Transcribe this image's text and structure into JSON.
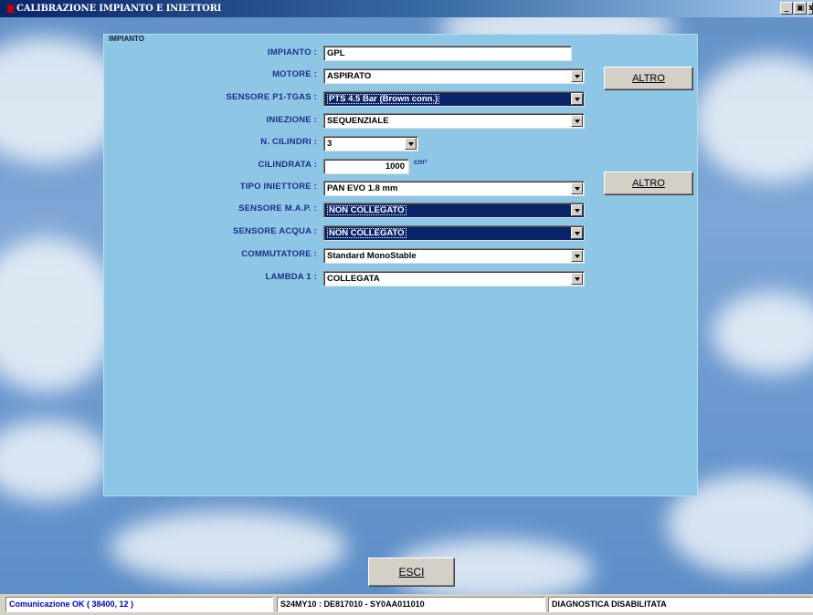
{
  "window": {
    "title": "CALIBRAZIONE IMPIANTO E INIETTORI",
    "minimize_icon": "minimize-icon",
    "restore_icon": "restore-icon",
    "close_icon": "close-icon"
  },
  "section": {
    "title": "IMPIANTO"
  },
  "fields": {
    "impianto": {
      "label": "IMPIANTO :",
      "value": "GPL"
    },
    "motore": {
      "label": "MOTORE :",
      "value": "ASPIRATO"
    },
    "sensore_p1": {
      "label": "SENSORE P1-TGAS :",
      "value": "PTS 4.5 Bar (Brown conn.)"
    },
    "iniezione": {
      "label": "INIEZIONE :",
      "value": "SEQUENZIALE"
    },
    "cilindri": {
      "label": "N. CILINDRI :",
      "value": "3"
    },
    "cilindrata": {
      "label": "CILINDRATA :",
      "value": "1000",
      "unit": "cm³"
    },
    "tipo_iniettore": {
      "label": "TIPO INIETTORE :",
      "value": "PAN EVO 1.8 mm"
    },
    "sensore_map": {
      "label": "SENSORE M.A.P. :",
      "value": "NON COLLEGATO"
    },
    "sensore_acqua": {
      "label": "SENSORE ACQUA :",
      "value": "NON COLLEGATO"
    },
    "commutatore": {
      "label": "COMMUTATORE :",
      "value": "Standard MonoStable"
    },
    "lambda": {
      "label": "LAMBDA 1 :",
      "value": "COLLEGATA"
    }
  },
  "buttons": {
    "altro_1": "ALTRO",
    "altro_2": "ALTRO",
    "esci": "ESCI"
  },
  "status": {
    "comm": "Comunicazione OK ( 38400,  12 )",
    "ids": "S24MY10 : DE817010 - SY0AA011010",
    "diag": "DIAGNOSTICA DISABILITATA"
  },
  "colors": {
    "label": "#202f8a",
    "status_comm": "#0000c0",
    "status_ids": "#000000",
    "panel": "#8ec6e6"
  }
}
